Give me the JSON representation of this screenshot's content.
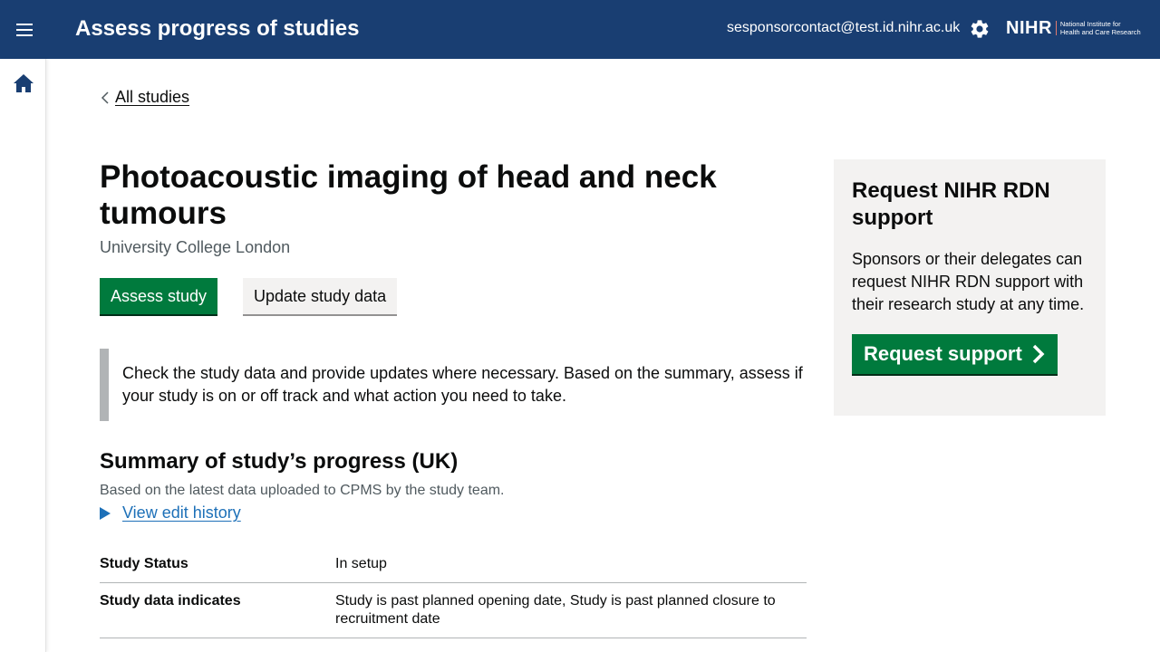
{
  "header": {
    "app_title": "Assess progress of studies",
    "user_email": "sesponsorcontact@test.id.nihr.ac.uk",
    "logo_main": "NIHR",
    "logo_line1": "National Institute for",
    "logo_line2": "Health and Care Research",
    "icons": [
      "menu-icon",
      "gear-icon"
    ]
  },
  "sidebar": {
    "icons": [
      "home-icon"
    ]
  },
  "breadcrumb": {
    "back_label": "All studies"
  },
  "study": {
    "title": "Photoacoustic imaging of head and neck tumours",
    "organisation": "University College London"
  },
  "actions": {
    "assess_label": "Assess study",
    "update_label": "Update study data"
  },
  "inset_text": "Check the study data and provide updates where necessary. Based on the summary, assess if your study is on or off track and what action you need to take.",
  "summary": {
    "heading": "Summary of study’s progress (UK)",
    "subheading": "Based on the latest data uploaded to CPMS by the study team.",
    "edit_history_label": "View edit history",
    "rows": [
      {
        "key": "Study Status",
        "value": "In setup"
      },
      {
        "key": "Study data indicates",
        "value": "Study is past planned opening date, Study is past planned closure to recruitment date"
      }
    ]
  },
  "aside": {
    "heading": "Request NIHR RDN support",
    "text": "Sponsors or their delegates can request NIHR RDN support with their research study at any time.",
    "button_label": "Request support"
  },
  "colors": {
    "header_bg": "#193e72",
    "primary_button": "#007a3d",
    "link": "#1d70b8",
    "aside_bg": "#f3f2f1",
    "inset_border": "#b1b4b6"
  }
}
